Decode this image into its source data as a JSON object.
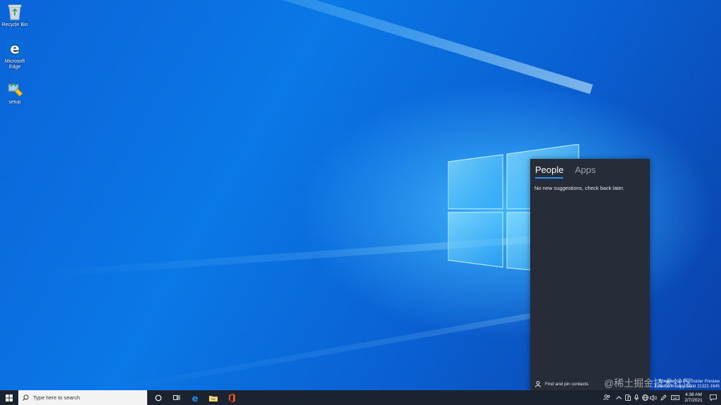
{
  "desktop": {
    "icons": [
      {
        "label": "Recycle Bin",
        "icon": "recycle-bin-icon"
      },
      {
        "label": "Microsoft Edge",
        "icon": "edge-icon"
      },
      {
        "label": "setup",
        "icon": "setup-icon"
      }
    ]
  },
  "people_panel": {
    "tabs": [
      {
        "label": "People",
        "active": true
      },
      {
        "label": "Apps",
        "active": false
      }
    ],
    "message": "No new suggestions, check back later.",
    "footer_label": "Find and pin contacts"
  },
  "watermark": {
    "build_line1": "Windows 10 Pro Insider Preview",
    "build_line2": "Evaluation copy. Build 21322-1645",
    "site": "@稀土掘金技术社区"
  },
  "taskbar": {
    "search_placeholder": "Type here to search",
    "clock_time": "4:38 AM",
    "clock_date": "2/7/2021"
  },
  "colors": {
    "accent": "#2d8ff0",
    "panel_bg": "#262d38",
    "taskbar_bg": "#1c2330"
  }
}
